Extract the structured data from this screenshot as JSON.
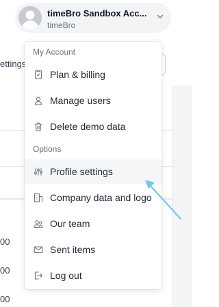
{
  "background": {
    "settings_fragment": "ettings",
    "numbers": [
      "00",
      "00",
      "00",
      "00"
    ]
  },
  "account": {
    "name": "timeBro Sandbox Acc...",
    "subtitle": "timeBro"
  },
  "menu": {
    "my_account_label": "My Account",
    "options_label": "Options",
    "items": [
      {
        "label": "Plan & billing",
        "icon": "plan-billing-icon"
      },
      {
        "label": "Manage users",
        "icon": "user-icon"
      },
      {
        "label": "Delete demo data",
        "icon": "trash-icon"
      },
      {
        "label": "Profile settings",
        "icon": "sliders-icon"
      },
      {
        "label": "Company data and logo",
        "icon": "building-icon"
      },
      {
        "label": "Our team",
        "icon": "team-icon"
      },
      {
        "label": "Sent items",
        "icon": "mail-icon"
      },
      {
        "label": "Log out",
        "icon": "logout-icon"
      }
    ]
  },
  "colors": {
    "accent_arrow": "#7cc4e6",
    "hover_row": "#f5f6f8"
  }
}
